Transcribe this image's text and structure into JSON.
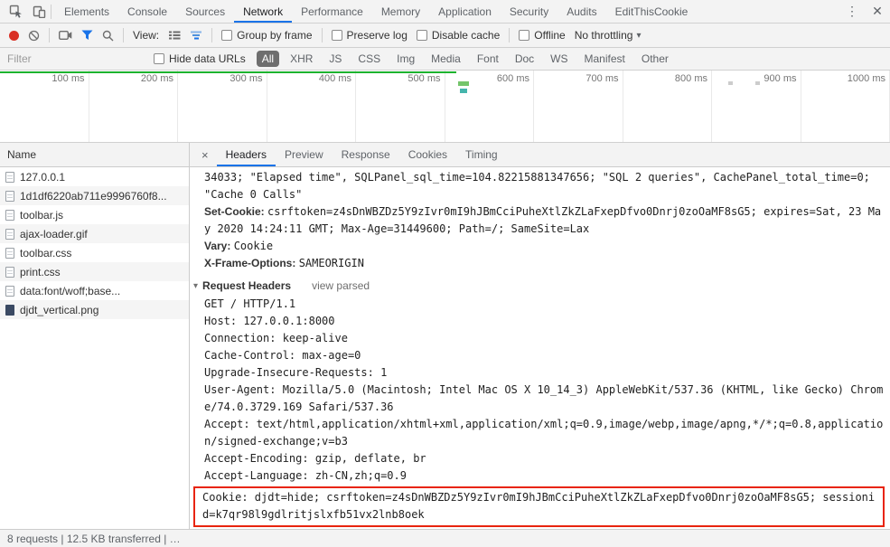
{
  "tabbar": {
    "tabs": [
      "Elements",
      "Console",
      "Sources",
      "Network",
      "Performance",
      "Memory",
      "Application",
      "Security",
      "Audits",
      "EditThisCookie"
    ],
    "active_tab": "Network"
  },
  "icons": {
    "menu": "⋮",
    "close": "✕",
    "caret": "▾",
    "detail_close": "×",
    "disclosure": "▾"
  },
  "toolbar": {
    "view_label": "View:",
    "group_by_frame": "Group by frame",
    "preserve_log": "Preserve log",
    "disable_cache": "Disable cache",
    "offline": "Offline",
    "throttling": "No throttling"
  },
  "filter_bar": {
    "placeholder": "Filter",
    "hide_data_urls": "Hide data URLs",
    "type_filters": [
      "All",
      "XHR",
      "JS",
      "CSS",
      "Img",
      "Media",
      "Font",
      "Doc",
      "WS",
      "Manifest",
      "Other"
    ],
    "active_type_filter": "All"
  },
  "timeline": {
    "tick_labels": [
      "100 ms",
      "200 ms",
      "300 ms",
      "400 ms",
      "500 ms",
      "600 ms",
      "700 ms",
      "800 ms",
      "900 ms",
      "1000 ms"
    ]
  },
  "requests": {
    "name_header": "Name",
    "rows": [
      "127.0.0.1",
      "1d1df6220ab711e9996760f8...",
      "toolbar.js",
      "ajax-loader.gif",
      "toolbar.css",
      "print.css",
      "data:font/woff;base...",
      "djdt_vertical.png"
    ]
  },
  "details": {
    "tabs": [
      "Headers",
      "Preview",
      "Response",
      "Cookies",
      "Timing"
    ],
    "active_tab": "Headers",
    "response_tail": "34033; \"Elapsed time\", SQLPanel_sql_time=104.82215881347656; \"SQL 2 queries\", CachePanel_total_time=0; \"Cache 0 Calls\"",
    "parsed_headers": [
      {
        "name": "Set-Cookie:",
        "value": "csrftoken=z4sDnWBZDz5Y9zIvr0mI9hJBmCciPuheXtlZkZLaFxepDfvo0Dnrj0zoOaMF8sG5; expires=Sat, 23 May 2020 14:24:11 GMT; Max-Age=31449600; Path=/; SameSite=Lax"
      },
      {
        "name": "Vary:",
        "value": "Cookie"
      },
      {
        "name": "X-Frame-Options:",
        "value": "SAMEORIGIN"
      }
    ],
    "request_headers_title": "Request Headers",
    "view_toggle": "view parsed",
    "raw_request_headers": [
      "GET / HTTP/1.1",
      "Host: 127.0.0.1:8000",
      "Connection: keep-alive",
      "Cache-Control: max-age=0",
      "Upgrade-Insecure-Requests: 1",
      "User-Agent: Mozilla/5.0 (Macintosh; Intel Mac OS X 10_14_3) AppleWebKit/537.36 (KHTML, like Gecko) Chrome/74.0.3729.169 Safari/537.36",
      "Accept: text/html,application/xhtml+xml,application/xml;q=0.9,image/webp,image/apng,*/*;q=0.8,application/signed-exchange;v=b3",
      "Accept-Encoding: gzip, deflate, br",
      "Accept-Language: zh-CN,zh;q=0.9"
    ],
    "highlighted_header": "Cookie: djdt=hide; csrftoken=z4sDnWBZDz5Y9zIvr0mI9hJBmCciPuheXtlZkZLaFxepDfvo0Dnrj0zoOaMF8sG5; sessionid=k7qr98l9gdlritjslxfb51vx2lnb8oek"
  },
  "status_bar": {
    "text": "8 requests | 12.5 KB transferred | …"
  },
  "colors": {
    "accent_blue": "#1a73e8",
    "record_red": "#d93025",
    "highlight_red": "#e8240c",
    "selected_pill_bg": "#6e6e6e",
    "timeline_green": "#1db32f",
    "toolbar_bg": "#f3f3f3"
  }
}
